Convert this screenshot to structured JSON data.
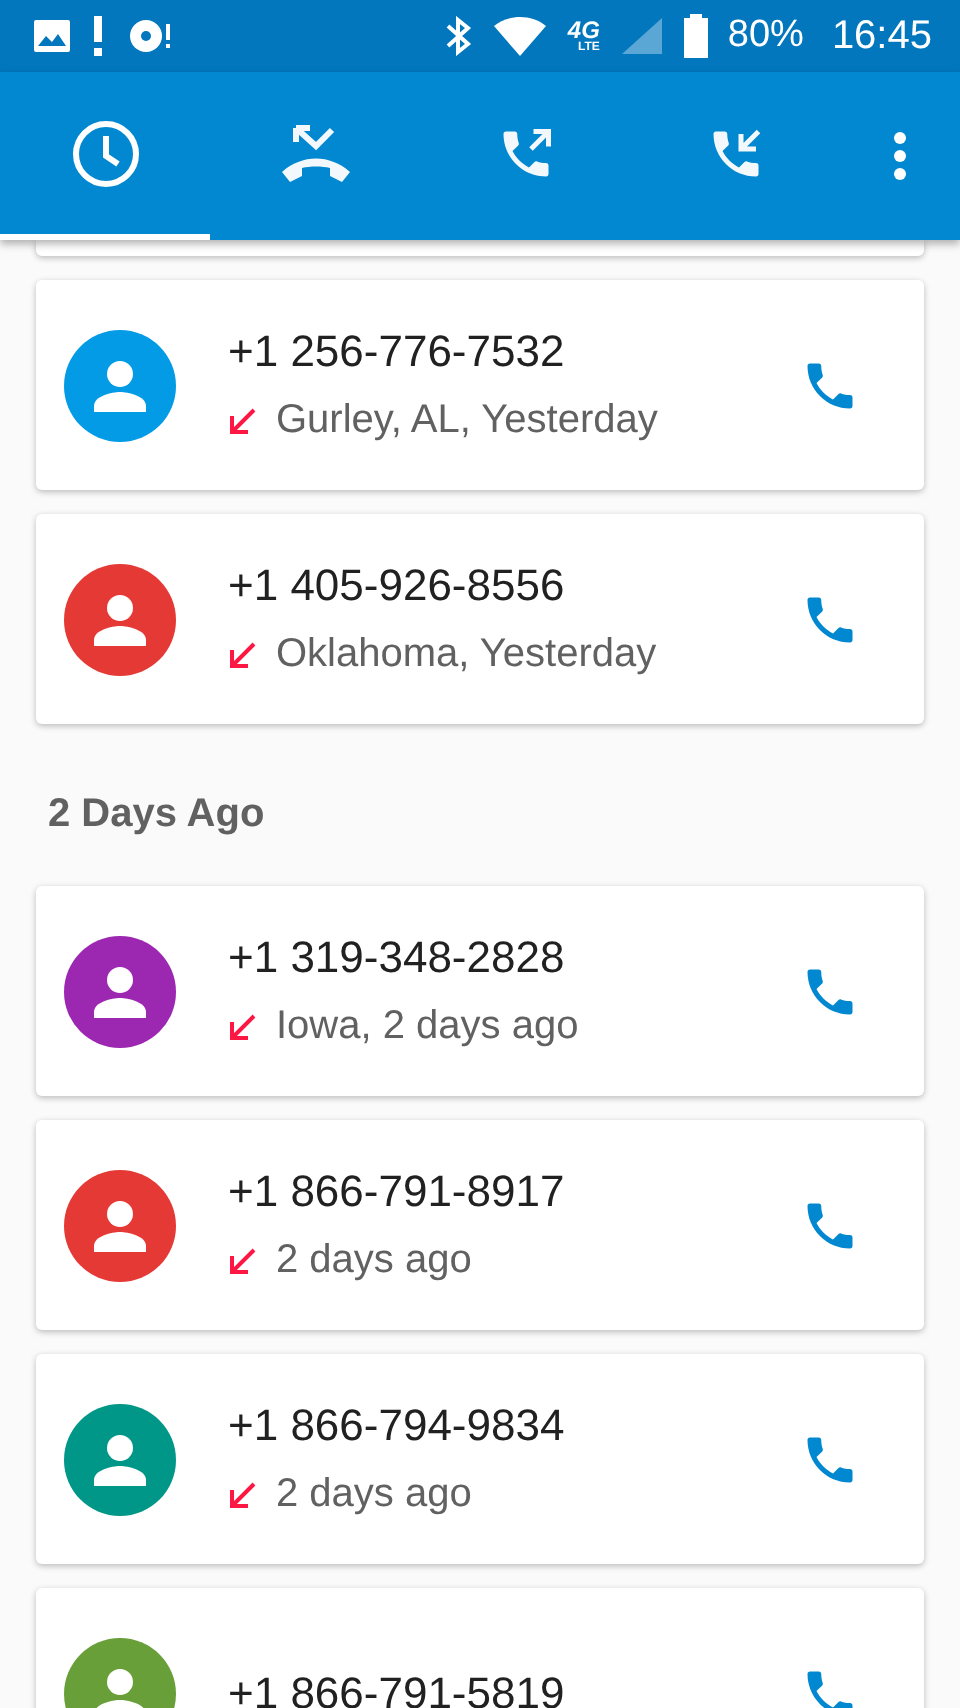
{
  "status_bar": {
    "network": "4G",
    "network_sub": "LTE",
    "battery": "80%",
    "time": "16:45"
  },
  "tabs": [
    {
      "kind": "recent",
      "selected": true
    },
    {
      "kind": "missed",
      "selected": false
    },
    {
      "kind": "outgoing",
      "selected": false
    },
    {
      "kind": "incoming",
      "selected": false
    }
  ],
  "sections": [
    {
      "calls": [
        {
          "number": "+1 256-776-7532",
          "detail": "Gurley, AL, Yesterday",
          "kind": "incoming",
          "color": "#039be5"
        },
        {
          "number": "+1 405-926-8556",
          "detail": "Oklahoma, Yesterday",
          "kind": "incoming",
          "color": "#e53935"
        }
      ]
    },
    {
      "title": "2 Days Ago",
      "calls": [
        {
          "number": "+1 319-348-2828",
          "detail": "Iowa, 2 days ago",
          "kind": "incoming",
          "color": "#9c27b0"
        },
        {
          "number": "+1 866-791-8917",
          "detail": "2 days ago",
          "kind": "incoming",
          "color": "#e53935"
        },
        {
          "number": "+1 866-794-9834",
          "detail": "2 days ago",
          "kind": "incoming",
          "color": "#009688"
        },
        {
          "number": "+1 866-791-5819",
          "color": "#689f38"
        }
      ]
    }
  ]
}
